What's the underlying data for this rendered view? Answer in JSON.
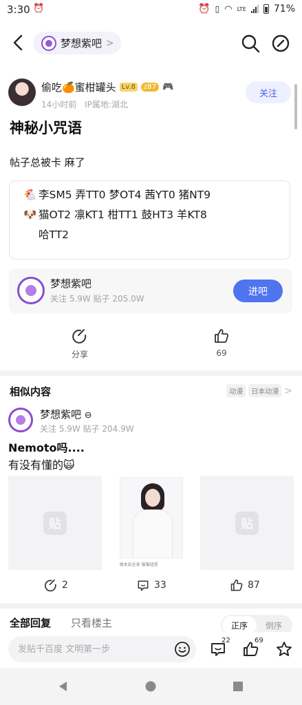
{
  "status_bar": {
    "time": "3:30",
    "battery": "71%",
    "network": "LTE"
  },
  "header": {
    "forum_name": "梦想紫吧"
  },
  "post": {
    "author_name": "偷吃🍊蜜柑罐头",
    "level": "Lv.8",
    "badge": "z87",
    "time_ago": "14小时前",
    "ip_location": "IP属地:湖北",
    "follow_label": "关注",
    "title": "神秘小咒语",
    "text": "帖子总被卡 麻了",
    "spell_lines": [
      {
        "emoji": "🐔",
        "text": "李SM5 弄TT0 梦OT4 茜YT0 猪NT9"
      },
      {
        "emoji": "🐶",
        "text": "猫OT2 凛KT1 柑TT1 鼓HT3 羊KT8"
      },
      {
        "emoji": "",
        "text": "哈TT2"
      }
    ]
  },
  "forum_card": {
    "name": "梦想紫吧",
    "stats": "关注 5.9W  贴子 205.0W",
    "enter_label": "进吧"
  },
  "actions": {
    "share_label": "分享",
    "like_count": "69"
  },
  "similar": {
    "heading": "相似内容",
    "tags": [
      "动漫",
      "日本动漫"
    ],
    "forum_name": "梦想紫吧",
    "forum_stats": "关注 5.9W  贴子 204.9W",
    "title": "Nemoto吗....",
    "subtitle": "有没有懂的🙀",
    "placeholder_glyph": "贴",
    "photo_caption": "根本凪全身  猫猫扭捏",
    "comment_count": "2",
    "reply_count": "33",
    "like_count": "87"
  },
  "replies": {
    "heading": "全部回复",
    "only_op": "只看楼主",
    "order_asc": "正序",
    "order_desc": "倒序"
  },
  "bottom_bar": {
    "input_placeholder": "发贴千百度 文明第一步",
    "comment_count": "22",
    "like_count": "69"
  },
  "colors": {
    "accent": "#4f74f0",
    "forum_purple": "#8a4cd1",
    "follow_bg": "#eef0ff"
  }
}
